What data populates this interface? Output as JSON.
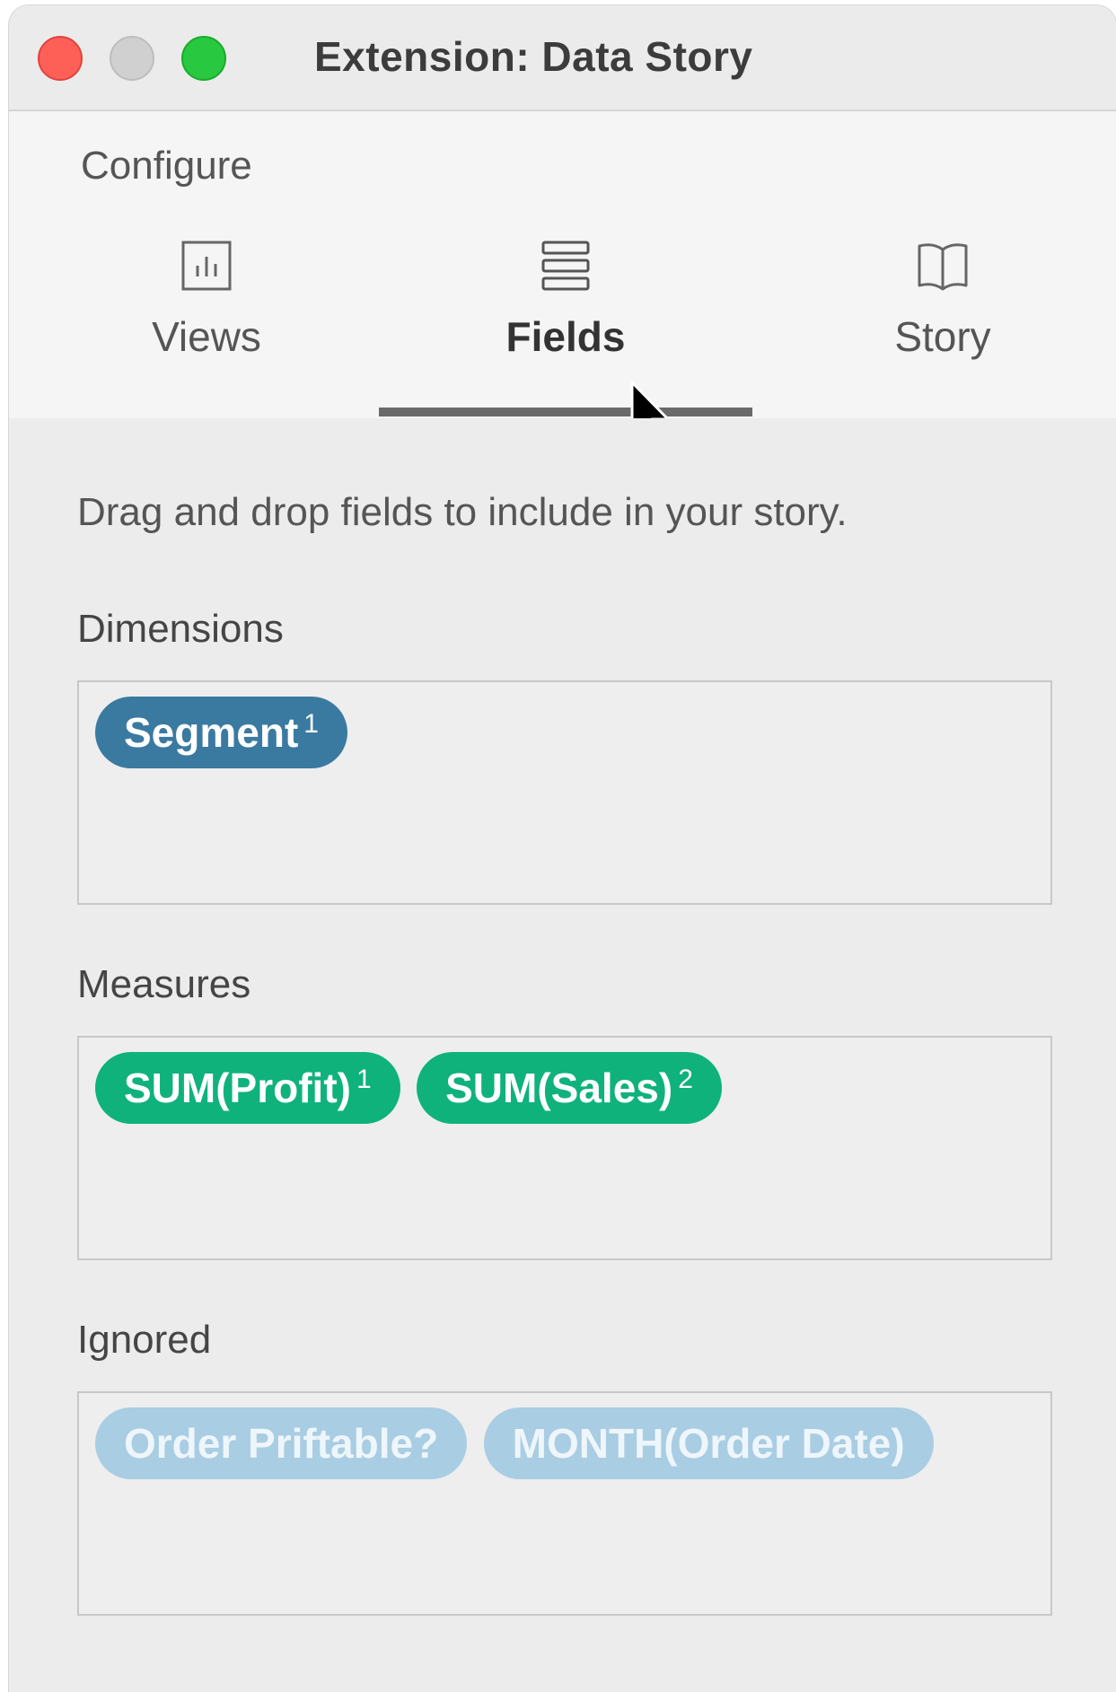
{
  "window": {
    "title": "Extension: Data Story"
  },
  "header": {
    "configure_label": "Configure",
    "tabs": [
      {
        "label": "Views",
        "icon": "bar-chart-icon",
        "active": false
      },
      {
        "label": "Fields",
        "icon": "list-rows-icon",
        "active": true
      },
      {
        "label": "Story",
        "icon": "open-book-icon",
        "active": false
      }
    ]
  },
  "content": {
    "instructions": "Drag and drop fields to include in your story.",
    "dimensions": {
      "label": "Dimensions",
      "fields": [
        {
          "name": "Segment",
          "index": "1"
        }
      ]
    },
    "measures": {
      "label": "Measures",
      "fields": [
        {
          "name": "SUM(Profit)",
          "index": "1"
        },
        {
          "name": "SUM(Sales)",
          "index": "2"
        }
      ]
    },
    "ignored": {
      "label": "Ignored",
      "fields": [
        {
          "name": "Order Priftable?"
        },
        {
          "name": "MONTH(Order Date)"
        }
      ]
    }
  },
  "colors": {
    "dimension_pill": "#3a7aa0",
    "measure_pill": "#0fb27a",
    "ignored_pill": "#a9cde3",
    "close_button": "#fe5f57",
    "zoom_button": "#28c840"
  }
}
